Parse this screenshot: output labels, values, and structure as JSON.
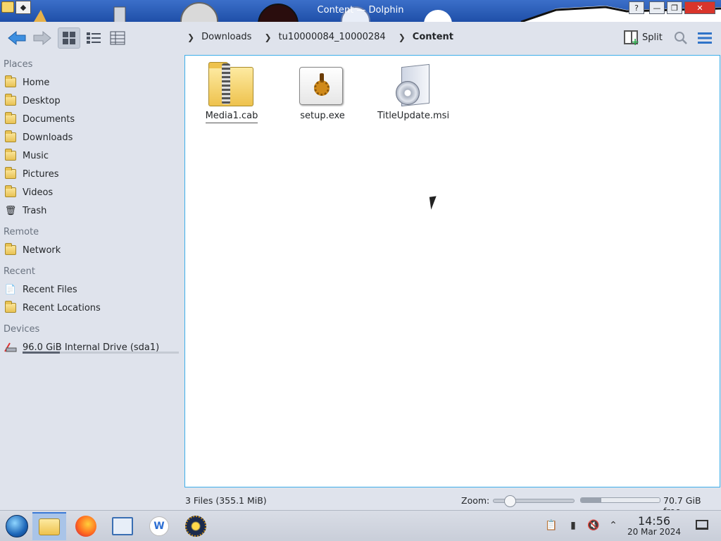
{
  "window": {
    "title": "Content — Dolphin",
    "help_label": "?",
    "minimize_label": "—",
    "maximize_label": "❐",
    "close_label": "✕"
  },
  "toolbar": {
    "back_icon": "arrow-left-icon",
    "forward_icon": "arrow-right-icon",
    "view_modes": [
      "icons-view-icon",
      "compact-view-icon",
      "details-view-icon"
    ],
    "active_view": "icons",
    "split_label": "Split"
  },
  "breadcrumb": {
    "items": [
      "Downloads",
      "tu10000084_10000284",
      "Content"
    ]
  },
  "sidebar": {
    "places_label": "Places",
    "places": [
      {
        "label": "Home",
        "icon": "home-folder-icon"
      },
      {
        "label": "Desktop",
        "icon": "desktop-folder-icon"
      },
      {
        "label": "Documents",
        "icon": "documents-folder-icon"
      },
      {
        "label": "Downloads",
        "icon": "downloads-folder-icon"
      },
      {
        "label": "Music",
        "icon": "music-folder-icon"
      },
      {
        "label": "Pictures",
        "icon": "pictures-folder-icon"
      },
      {
        "label": "Videos",
        "icon": "videos-folder-icon"
      },
      {
        "label": "Trash",
        "icon": "trash-icon"
      }
    ],
    "remote_label": "Remote",
    "remote": [
      {
        "label": "Network",
        "icon": "network-folder-icon"
      }
    ],
    "recent_label": "Recent",
    "recent": [
      {
        "label": "Recent Files",
        "icon": "recent-files-icon"
      },
      {
        "label": "Recent Locations",
        "icon": "recent-locations-icon"
      }
    ],
    "devices_label": "Devices",
    "devices": [
      {
        "label": "96.0 GiB Internal Drive (sda1)",
        "icon": "hard-drive-icon",
        "used_fraction": 0.24
      }
    ]
  },
  "files": [
    {
      "name": "Media1.cab",
      "icon": "archive-icon"
    },
    {
      "name": "setup.exe",
      "icon": "executable-icon"
    },
    {
      "name": "TitleUpdate.msi",
      "icon": "installer-package-icon"
    }
  ],
  "statusbar": {
    "summary": "3 Files (355.1 MiB)",
    "zoom_label": "Zoom:",
    "zoom_fraction": 0.2,
    "free_space": "70.7 GiB free",
    "used_fraction": 0.26
  },
  "taskbar": {
    "apps": [
      "start-menu-icon",
      "file-manager-icon",
      "firefox-icon",
      "system-settings-icon",
      "wps-office-icon",
      "wine-icon"
    ],
    "wps_label": "W",
    "clock_time": "14:56",
    "clock_date": "20 Mar 2024",
    "tray": [
      "clipboard-icon",
      "battery-icon",
      "speaker-muted-icon",
      "chevron-up-icon"
    ]
  },
  "colors": {
    "accent": "#3daee9",
    "titlebar": "#1f4fa8",
    "sidebar_bg": "#dfe3ec"
  }
}
